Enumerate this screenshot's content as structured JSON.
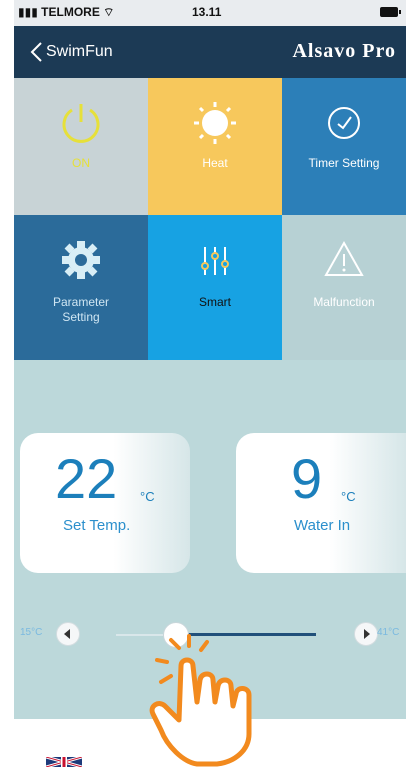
{
  "status_bar": {
    "carrier": "TELMORE",
    "time": "13.11"
  },
  "nav": {
    "back_label": "SwimFun",
    "title": "Alsavo Pro"
  },
  "tiles": [
    {
      "label": "ON",
      "icon": "power-icon",
      "color": "#e6e03a"
    },
    {
      "label": "Heat",
      "icon": "sun-icon",
      "color": "#ffffff"
    },
    {
      "label": "Timer Setting",
      "icon": "clock-icon",
      "color": "#ffffff"
    },
    {
      "label": "Parameter Setting",
      "icon": "gear-icon",
      "color": "#ffffff"
    },
    {
      "label": "Smart",
      "icon": "sliders-icon",
      "color": "#111111"
    },
    {
      "label": "Malfunction",
      "icon": "warning-icon",
      "color": "#ffffff"
    }
  ],
  "set_temp": {
    "value": "22",
    "unit": "°C",
    "label": "Set Temp."
  },
  "water_in": {
    "value": "9",
    "unit": "°C",
    "label": "Water In"
  },
  "slider": {
    "min_label": "15°C",
    "max_label": "41°C",
    "current": 22,
    "min": 15,
    "max": 41
  },
  "colors": {
    "nav": "#1c3a55",
    "accent": "#1c7fbb",
    "hand": "#f28a1e"
  }
}
